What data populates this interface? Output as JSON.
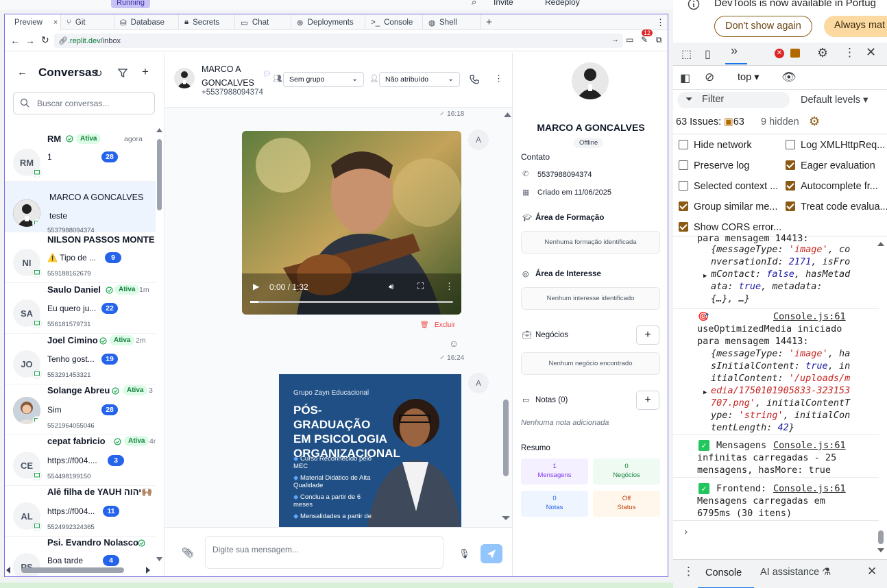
{
  "top": {
    "running": "Running",
    "invite": "Invite",
    "redeploy": "Redeploy"
  },
  "tabs": [
    {
      "label": "Preview",
      "close": "×"
    },
    {
      "label": "Git"
    },
    {
      "label": "Database"
    },
    {
      "label": "Secrets"
    },
    {
      "label": "Chat"
    },
    {
      "label": "Deployments"
    },
    {
      "label": "Console"
    },
    {
      "label": "Shell"
    }
  ],
  "address": {
    "host": ".replit.dev",
    "path": "/inbox",
    "badge": "12"
  },
  "left": {
    "title": "Conversas",
    "search_placeholder": "Buscar conversas...",
    "conversations": [
      {
        "initials": "RM",
        "name": "RM",
        "badge": "Ativa",
        "time": "agora",
        "msg": "1",
        "count": "28",
        "phone": ""
      },
      {
        "initials": "",
        "name": "MARCO A GONCALVES",
        "badge": "",
        "time": "",
        "msg": "teste",
        "count": "",
        "phone": "5537988094374"
      },
      {
        "initials": "NI",
        "name": "NILSON PASSOS MONTE",
        "badge": "",
        "time": "",
        "msg": "⚠️ Tipo de ...",
        "count": "9",
        "phone": "559188162679"
      },
      {
        "initials": "SA",
        "name": "Saulo Daniel",
        "badge": "Ativa",
        "time": "1m",
        "msg": "Eu quero ju...",
        "count": "22",
        "phone": "556181579731"
      },
      {
        "initials": "JO",
        "name": "Joel Cimino",
        "badge": "Ativa",
        "time": "2m",
        "msg": "Tenho gost...",
        "count": "19",
        "phone": "553291453321"
      },
      {
        "initials": "",
        "name": "Solange Abreu",
        "badge": "Ativa",
        "time": "3",
        "msg": "Sim",
        "count": "28",
        "phone": "5521964055046"
      },
      {
        "initials": "CE",
        "name": "cepat fabricio",
        "badge": "Ativa",
        "time": "4n",
        "msg": "https://f004....",
        "count": "3",
        "phone": "554498199150"
      },
      {
        "initials": "AL",
        "name": "Alê filha de YAUH יהוה🙌🏽",
        "badge": "",
        "time": "",
        "msg": "https://f004...",
        "count": "11",
        "phone": "5524992324365"
      },
      {
        "initials": "PS",
        "name": "Psi. Evandro Nolasco",
        "badge": "",
        "time": "",
        "msg": "Boa tarde",
        "count": "4",
        "phone": ""
      }
    ]
  },
  "chat": {
    "name": "MARCO A GONCALVES",
    "phone": "+5537988094374",
    "group_select": "Sem grupo",
    "assign_select": "Não atribuído",
    "time_top": "16:18",
    "video_time": "0:00 / 1:32",
    "delete_label": "Excluir",
    "time_video": "16:24",
    "sender_avatar": "A",
    "poster": {
      "brand": "Grupo Zayn Educacional",
      "headline": "PÓS-GRADUAÇÃO EM PSICOLOGIA ORGANIZACIONAL",
      "bullets": [
        "Curso Reconhecido pelo MEC",
        "Material Didático de Alta Qualidade",
        "Conclua a partir de 6 meses",
        "Mensalidades a partir de"
      ]
    },
    "input_placeholder": "Digite sua mensagem..."
  },
  "contact": {
    "name": "MARCO A GONCALVES",
    "status": "Offline",
    "contact_title": "Contato",
    "phone": "5537988094374",
    "created": "Criado em 11/06/2025",
    "formacao_title": "Área de Formação",
    "formacao_empty": "Nenhuma formação identificada",
    "interesse_title": "Área de Interesse",
    "interesse_empty": "Nenhum interesse identificado",
    "negocios_title": "Negócios",
    "negocios_empty": "Nenhum negócio encontrado",
    "notas_title": "Notas (0)",
    "notas_empty": "Nenhuma nota adicionada",
    "resumo_title": "Resumo",
    "stats": [
      {
        "value": "1",
        "label": "Mensagens",
        "color": "#7c3aed",
        "bg": "#f5f0ff"
      },
      {
        "value": "0",
        "label": "Negócios",
        "color": "#15803d",
        "bg": "#effaf2"
      },
      {
        "value": "0",
        "label": "Notas",
        "color": "#2563eb",
        "bg": "#eef5ff"
      },
      {
        "value": "Off",
        "label": "Status",
        "color": "#c2410c",
        "bg": "#fff6ec"
      }
    ]
  },
  "devtools": {
    "banner": "DevTools is now available in Portug",
    "dont_show": "Don't show again",
    "always_match": "Always mat",
    "context": "top",
    "filter": "Filter",
    "levels": "Default levels",
    "issues_label": "63 Issues:",
    "issues_count": "63",
    "hidden": "9 hidden",
    "options": [
      {
        "label": "Hide network",
        "checked": false
      },
      {
        "label": "Log XMLHttpReq...",
        "checked": false
      },
      {
        "label": "Preserve log",
        "checked": false
      },
      {
        "label": "Eager evaluation",
        "checked": true
      },
      {
        "label": "Selected context ...",
        "checked": false
      },
      {
        "label": "Autocomplete fr...",
        "checked": true
      },
      {
        "label": "Group similar me...",
        "checked": true
      },
      {
        "label": "Treat code evalua...",
        "checked": true
      },
      {
        "label": "Show CORS error...",
        "checked": true
      }
    ],
    "source": "Console.js:61",
    "logs": {
      "l1a": "para mensagem 14413:",
      "l2a": "useOptimizedMedia iniciado",
      "l2b": "para mensagem 14413:",
      "l3a": "Mensagens",
      "l3b": "infinitas carregadas - 25",
      "l3c": "mensagens, hasMore: true",
      "l4a": "Frontend:",
      "l4b": "Mensagens carregadas em",
      "l4c": "6795ms (30 itens)"
    },
    "tab_console": "Console",
    "tab_ai": "AI assistance"
  }
}
